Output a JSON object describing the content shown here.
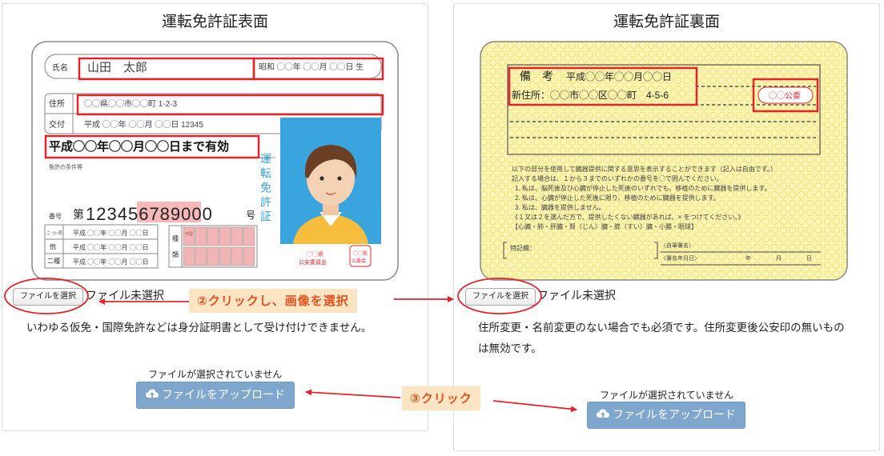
{
  "front": {
    "title": "運転免許証表面",
    "file_button": "ファイルを選択",
    "file_status": "ファイル未選択",
    "note": "いわゆる仮免・国際免許などは身分証明書として受け付けできません。",
    "upload_status": "ファイルが選択されていません",
    "upload_button": "ファイルをアップロード",
    "card": {
      "name_label": "氏名",
      "name": "山田　太郎",
      "birth": "昭和 ◯◯年 ◯◯月 ◯◯日 生",
      "address_label": "住所",
      "address": "◯◯県◯◯市◯◯町 1-2-3",
      "issue_label": "交付",
      "issue": "平成 ◯◯年 ◯◯月 ◯◯日 12345",
      "valid_until": "平成◯◯年◯◯月◯◯日まで有効",
      "conditions_label": "免許の条件等",
      "number_label": "番号",
      "number_prefix": "第",
      "number_plain": "12345",
      "number_highlight": "6789",
      "number_tail": "000",
      "number_suffix": "号",
      "row1_label": "二･小･原",
      "row1": "平成 ◯◯年 ◯◯月 ◯◯日",
      "row2_label": "他",
      "row2": "平成 ◯◯年 ◯◯月 ◯◯日",
      "row3_label": "二種",
      "row3": "平成 ◯◯年 ◯◯月 ◯◯日",
      "type_label_1": "種",
      "type_label_2": "類",
      "type_chip": "中型",
      "vertical_title": "運転免許証",
      "issuer": "◯◯県\n公安委員会",
      "seal": "◯◯県公安委員会"
    }
  },
  "back": {
    "title": "運転免許証裏面",
    "file_button": "ファイルを選択",
    "file_status": "ファイル未選択",
    "note": "住所変更・名前変更のない場合でも必須です。住所変更後公安印の無いものは無効です。",
    "upload_status": "ファイルが選択されていません",
    "upload_button": "ファイルをアップロード",
    "card": {
      "remarks_label": "備　考",
      "remarks_date": "平成◯◯年◯◯月◯◯日",
      "new_address": "新住所：◯◯市◯◯区◯◯町　4-5-6",
      "stamp": "◯◯公委",
      "donor_lines": [
        "以下の部分を使用して臓器提供に関する意思を表示することができます（記入は自由です。）",
        "記入する場合は、１から３までのいずれかの番号を◯で囲んでください。",
        "1. 私は、脳死後及び心臓が停止した死後のいずれでも、移植のために臓器を提供します。",
        "2. 私は、心臓が停止した死後に限り、移植のために臓器を提供します。",
        "3. 私は、臓器を提供しません。",
        "《１又は２を選んだ方で、提供したくない臓器があれば、× をつけてください。》",
        "【心臓・肺・肝臓・腎（じん）臓・膵（すい）臓・小腸・眼球】"
      ],
      "special_label": "特記欄：",
      "signature_label": "〈自筆署名〉",
      "signature_date_label": "〈署名年月日〉",
      "year": "年",
      "month": "月",
      "day": "日"
    }
  },
  "callouts": {
    "select": "②クリックし、画像を選択",
    "upload": "③クリック"
  },
  "colors": {
    "highlight_red": "#e3242b",
    "callout_text": "#e4511f",
    "callout_bg": "#fde4c2",
    "upload_blue": "#7fa7cd",
    "card_blue": "#3aa4de",
    "back_yellow": "#fbf4b3"
  }
}
